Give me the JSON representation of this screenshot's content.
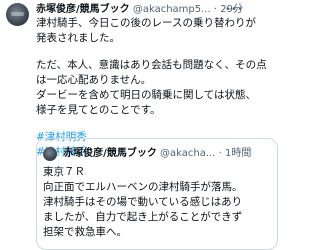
{
  "tweet": {
    "name": "赤塚俊彦/競馬ブック",
    "handle": "@akachamp5...",
    "separator": "·",
    "time": "29分",
    "more": "•••",
    "lines": [
      "津村騎手、今日この後のレースの乗り替わりが",
      "発表されました。",
      "ただ、本人、意識はあり会話も問題なく、その点",
      "は一応心配ありません。",
      "ダービーを含めて明日の騎乗に関しては状態、",
      "様子を見てとのことです。"
    ],
    "hashtags": [
      "#津村明秀",
      "#津村騎手"
    ]
  },
  "quote": {
    "name": "赤塚俊彦/競馬ブック",
    "handle": "@akacha...",
    "separator": "·",
    "time": "1時間",
    "lines": [
      "東京７Ｒ",
      "向正面でエルハーベンの津村騎手が落馬。",
      "津村騎手はその場で動いている感じはあり",
      "ましたが、自力で起き上がることができず",
      "担架で救急車へ。"
    ]
  }
}
